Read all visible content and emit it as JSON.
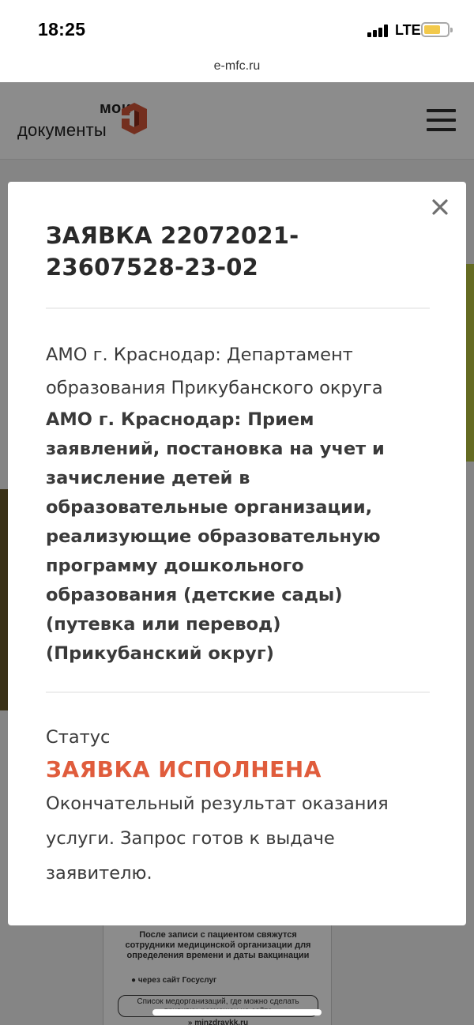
{
  "status_bar": {
    "time": "18:25",
    "network": "LTE"
  },
  "browser": {
    "url": "e-mfc.ru"
  },
  "site": {
    "logo_line1": "мои",
    "logo_line2": "документы",
    "brand_color": "#e05c3c"
  },
  "background_poster": {
    "text": "После записи с пациентом свяжутся сотрудники медицинской организации для определения времени и даты вакцинации",
    "bullet": "● через сайт Госуслуг",
    "box_text": "Список медорганизаций, где можно сделать прививку, размещен на сайте",
    "site": "» minzdravkk.ru"
  },
  "modal": {
    "title": "ЗАЯВКА 22072021-23607528-23-02",
    "department": "АМО г. Краснодар: Департамент образования Прикубанского округа",
    "service": "АМО г. Краснодар: Прием заявлений, постановка на учет и зачисление детей в образовательные организации, реализующие образовательную программу дошкольного образования (детские сады) (путевка или перевод) (Прикубанский округ)",
    "status_label": "Статус",
    "status_value": "ЗАЯВКА ИСПОЛНЕНА",
    "status_description": "Окончательный результат оказания услуги. Запрос готов к выдаче заявителю.",
    "status_color": "#e05c3c",
    "close_icon": "close-icon"
  }
}
